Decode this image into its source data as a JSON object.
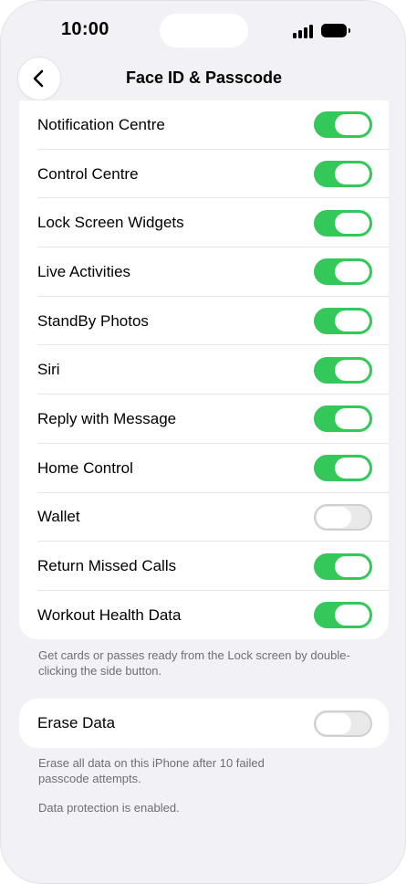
{
  "status_bar": {
    "time": "10:00"
  },
  "nav": {
    "title": "Face ID & Passcode"
  },
  "colors": {
    "accent_on": "#34c759",
    "toggle_off": "#e9e9ea",
    "background": "#f2f1f6"
  },
  "lock_screen_access": {
    "items": [
      {
        "label": "Notification Centre",
        "on": true
      },
      {
        "label": "Control Centre",
        "on": true
      },
      {
        "label": "Lock Screen Widgets",
        "on": true
      },
      {
        "label": "Live Activities",
        "on": true
      },
      {
        "label": "StandBy Photos",
        "on": true
      },
      {
        "label": "Siri",
        "on": true
      },
      {
        "label": "Reply with Message",
        "on": true
      },
      {
        "label": "Home Control",
        "on": true
      },
      {
        "label": "Wallet",
        "on": false
      },
      {
        "label": "Return Missed Calls",
        "on": true
      },
      {
        "label": "Workout Health Data",
        "on": true
      }
    ],
    "footer": "Get cards or passes ready from the Lock screen by double-clicking the side button."
  },
  "erase_data": {
    "label": "Erase Data",
    "on": false,
    "footer_line1": "Erase all data on this iPhone after 10 failed passcode attempts.",
    "footer_line2": "Data protection is enabled."
  }
}
